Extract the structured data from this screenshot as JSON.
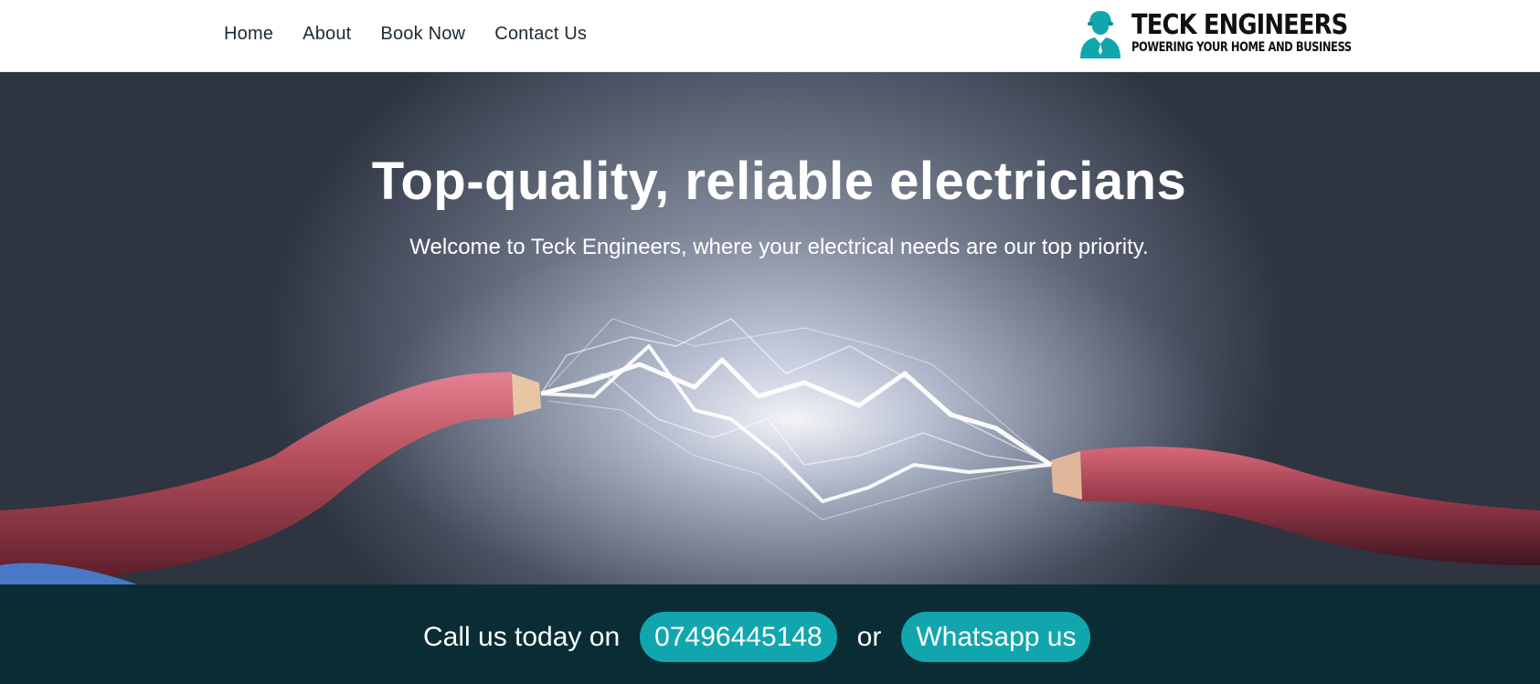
{
  "nav": {
    "items": [
      {
        "label": "Home"
      },
      {
        "label": "About"
      },
      {
        "label": "Book Now"
      },
      {
        "label": "Contact Us"
      }
    ]
  },
  "logo": {
    "title": "TECK ENGINEERS",
    "subtitle": "POWERING YOUR HOME AND BUSINESS",
    "icon": "electrician-person-icon",
    "color": "#11a6ae"
  },
  "hero": {
    "title": "Top-quality, reliable electricians",
    "subtitle": "Welcome to Teck Engineers, where your electrical needs are our top priority."
  },
  "cta": {
    "lead": "Call us today on",
    "phone": "07496445148",
    "or": "or",
    "whatsapp": "Whatsapp us"
  },
  "colors": {
    "accent": "#11a6ae",
    "cta_background": "#0a2d35",
    "wire": "#c0515f"
  }
}
